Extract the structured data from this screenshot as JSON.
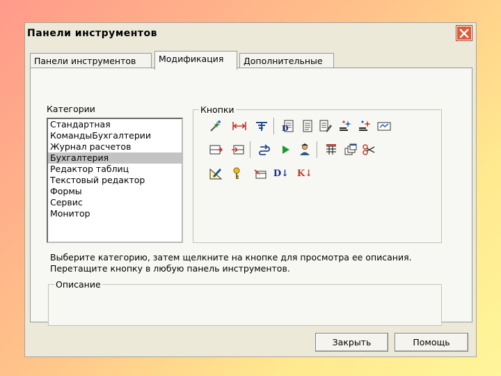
{
  "window": {
    "title": "Панели инструментов"
  },
  "tabs": [
    {
      "label": "Панели инструментов"
    },
    {
      "label": "Модификация"
    },
    {
      "label": "Дополнительные"
    }
  ],
  "categories": {
    "label": "Категории",
    "selected": "Бухгалтерия",
    "items": [
      "Стандартная",
      "КомандыБухгалтерии",
      "Журнал расчетов",
      "Бухгалтерия",
      "Редактор таблиц",
      "Текстовый редактор",
      "Формы",
      "Сервис",
      "Монитор"
    ]
  },
  "buttons_group": {
    "label": "Кнопки",
    "icons": [
      "wand-icon",
      "width-icon",
      "split-icon",
      "document-d-icon",
      "document-icon",
      "document-edit-icon",
      "sparkle-icon",
      "sparkle-list-icon",
      "form-icon",
      "insert-row-icon",
      "insert-row-alt-icon",
      "loop-icon",
      "play-icon",
      "user-icon",
      "table-icon",
      "windows-icon",
      "scissors-icon",
      "ruler-edit-icon",
      "key-icon",
      "card-icon",
      "d-down-icon",
      "k-down-icon"
    ],
    "text_icons": {
      "d": "D↓",
      "k": "K↓"
    }
  },
  "hint": "Выберите категорию, затем щелкните на кнопке для просмотра ее описания. Перетащите кнопку в любую панель инструментов.",
  "description": {
    "label": "Описание"
  },
  "footer": {
    "close_label": "Закрыть",
    "help_label": "Помощь"
  },
  "colors": {
    "dialog_bg": "#ece9d8",
    "close_button": "#e05a3a",
    "selected_row": "#c3c3c3"
  }
}
